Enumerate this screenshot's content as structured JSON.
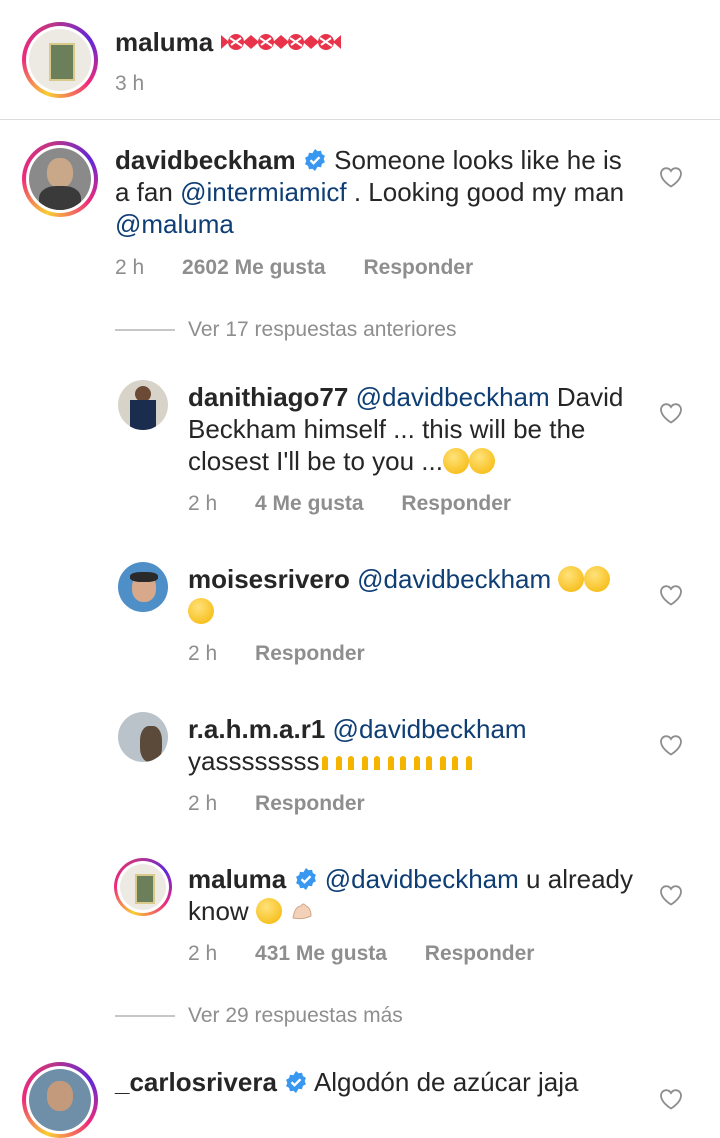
{
  "post": {
    "username": "maluma",
    "caption_emoji": [
      "candy-icon",
      "candy-icon",
      "candy-icon",
      "candy-icon"
    ],
    "time": "3 h"
  },
  "comment": {
    "username": "davidbeckham",
    "text_1": "Someone looks like he",
    "text_2": "is a fan",
    "mention_1": "@intermiamicf",
    "text_3": ". Looking good my",
    "text_4": "man",
    "mention_2": "@maluma",
    "time": "2 h",
    "likes": "2602 Me gusta",
    "reply": "Responder"
  },
  "view_previous": "Ver 17 respuestas anteriores",
  "replies": [
    {
      "username": "danithiago77",
      "mention": "@davidbeckham",
      "text_a": "David",
      "text_b": "Beckham himself ... this will be the",
      "text_c": "closest I'll be to you ...",
      "time": "2 h",
      "likes": "4 Me gusta",
      "reply": "Responder"
    },
    {
      "username": "moisesrivero",
      "mention": "@davidbeckham",
      "time": "2 h",
      "reply": "Responder"
    },
    {
      "username": "r.a.h.m.a.r1",
      "mention": "@davidbeckham",
      "text_a": "yassssssss",
      "time": "2 h",
      "reply": "Responder"
    },
    {
      "username": "maluma",
      "mention": "@davidbeckham",
      "text_a": "u",
      "text_b": "already know",
      "time": "2 h",
      "likes": "431 Me gusta",
      "reply": "Responder"
    }
  ],
  "view_more": "Ver 29 respuestas más",
  "next_comment": {
    "username": "_carlosrivera",
    "text": "Algodón de azúcar  jaja"
  },
  "colors": {
    "mention": "#0f3e75",
    "verified": "#3897f0",
    "meta": "#8e8e8e"
  }
}
